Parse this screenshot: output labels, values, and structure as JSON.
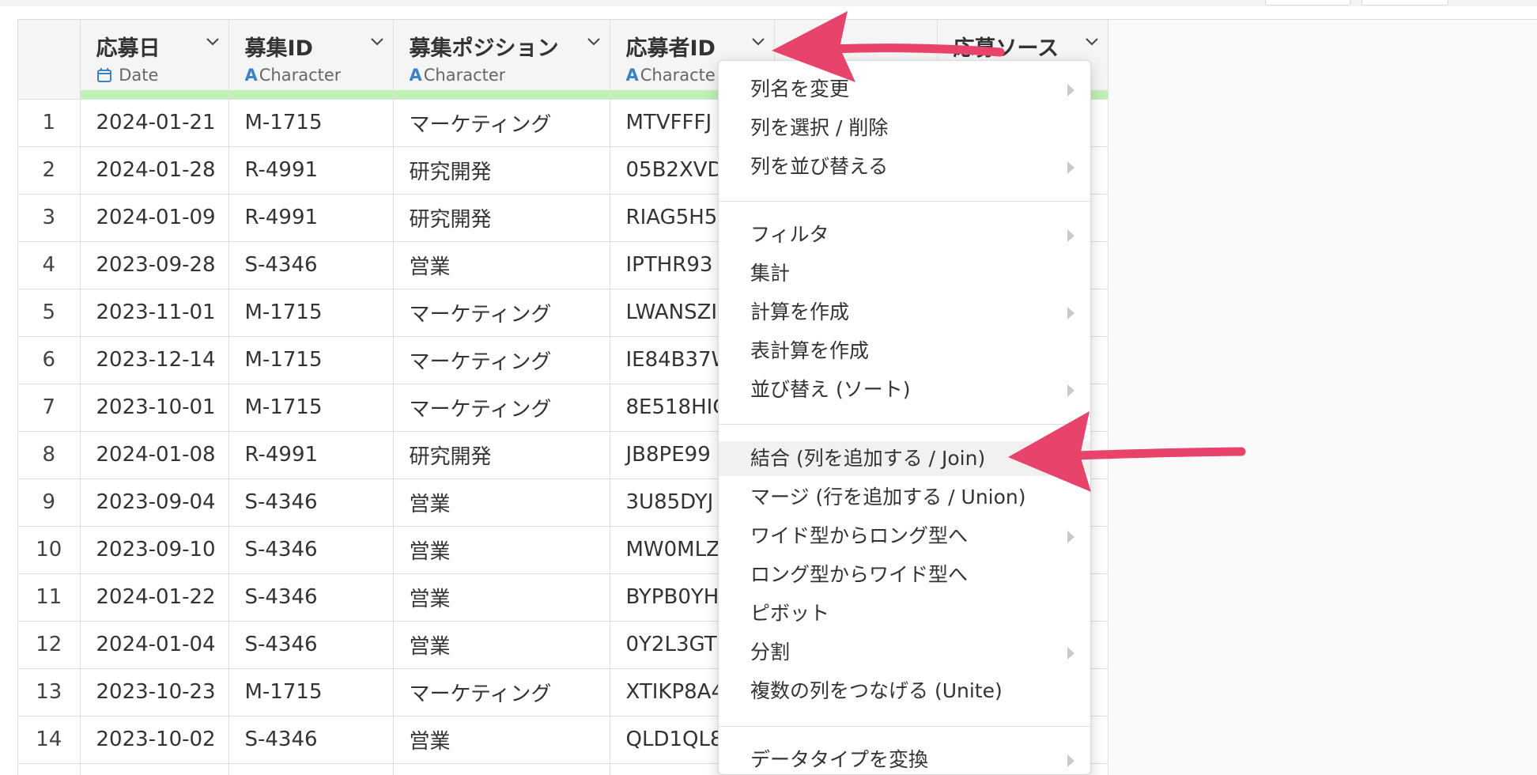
{
  "columns": [
    {
      "name": "",
      "type": "",
      "icon": ""
    },
    {
      "name": "応募日",
      "type": "Date",
      "icon": "calendar-icon"
    },
    {
      "name": "募集ID",
      "type": "Character",
      "icon": "character-type-icon"
    },
    {
      "name": "募集ポジション",
      "type": "Character",
      "icon": "character-type-icon"
    },
    {
      "name": "応募者ID",
      "type": "Characte",
      "icon": "character-type-icon"
    },
    {
      "name": "",
      "type": "",
      "icon": ""
    },
    {
      "name": "応募ソース",
      "type": "",
      "icon": ""
    }
  ],
  "rows": [
    {
      "n": "1",
      "date": "2024-01-21",
      "rid": "M-1715",
      "pos": "マーケティング",
      "aid": "MTVFFFJ"
    },
    {
      "n": "2",
      "date": "2024-01-28",
      "rid": "R-4991",
      "pos": "研究開発",
      "aid": "05B2XVD"
    },
    {
      "n": "3",
      "date": "2024-01-09",
      "rid": "R-4991",
      "pos": "研究開発",
      "aid": "RIAG5H5"
    },
    {
      "n": "4",
      "date": "2023-09-28",
      "rid": "S-4346",
      "pos": "営業",
      "aid": "IPTHR93"
    },
    {
      "n": "5",
      "date": "2023-11-01",
      "rid": "M-1715",
      "pos": "マーケティング",
      "aid": "LWANSZI"
    },
    {
      "n": "6",
      "date": "2023-12-14",
      "rid": "M-1715",
      "pos": "マーケティング",
      "aid": "IE84B37W"
    },
    {
      "n": "7",
      "date": "2023-10-01",
      "rid": "M-1715",
      "pos": "マーケティング",
      "aid": "8E518HIC"
    },
    {
      "n": "8",
      "date": "2024-01-08",
      "rid": "R-4991",
      "pos": "研究開発",
      "aid": "JB8PE99"
    },
    {
      "n": "9",
      "date": "2023-09-04",
      "rid": "S-4346",
      "pos": "営業",
      "aid": "3U85DYJ"
    },
    {
      "n": "10",
      "date": "2023-09-10",
      "rid": "S-4346",
      "pos": "営業",
      "aid": "MW0MLZ"
    },
    {
      "n": "11",
      "date": "2024-01-22",
      "rid": "S-4346",
      "pos": "営業",
      "aid": "BYPB0YH"
    },
    {
      "n": "12",
      "date": "2024-01-04",
      "rid": "S-4346",
      "pos": "営業",
      "aid": "0Y2L3GT"
    },
    {
      "n": "13",
      "date": "2023-10-23",
      "rid": "M-1715",
      "pos": "マーケティング",
      "aid": "XTIKP8A4"
    },
    {
      "n": "14",
      "date": "2023-10-02",
      "rid": "S-4346",
      "pos": "営業",
      "aid": "QLD1QL8"
    }
  ],
  "menu": {
    "items": [
      {
        "label": "列名を変更",
        "submenu": true
      },
      {
        "label": "列を選択 / 削除",
        "submenu": false
      },
      {
        "label": "列を並び替える",
        "submenu": true
      },
      {
        "label": "フィルタ",
        "submenu": true
      },
      {
        "label": "集計",
        "submenu": false
      },
      {
        "label": "計算を作成",
        "submenu": true
      },
      {
        "label": "表計算を作成",
        "submenu": false
      },
      {
        "label": "並び替え (ソート)",
        "submenu": true
      },
      {
        "label": "結合 (列を追加する / Join)",
        "submenu": false,
        "highlighted": true
      },
      {
        "label": "マージ (行を追加する / Union)",
        "submenu": false
      },
      {
        "label": "ワイド型からロング型へ",
        "submenu": true
      },
      {
        "label": "ロング型からワイド型へ",
        "submenu": false
      },
      {
        "label": "ピボット",
        "submenu": false
      },
      {
        "label": "分割",
        "submenu": true
      },
      {
        "label": "複数の列をつなげる (Unite)",
        "submenu": false
      },
      {
        "label": "データタイプを変換",
        "submenu": true
      }
    ]
  },
  "colors": {
    "annotation_arrow": "#e8436a",
    "quality_bar": "#bff0b4",
    "type_icon": "#3b82c4"
  }
}
